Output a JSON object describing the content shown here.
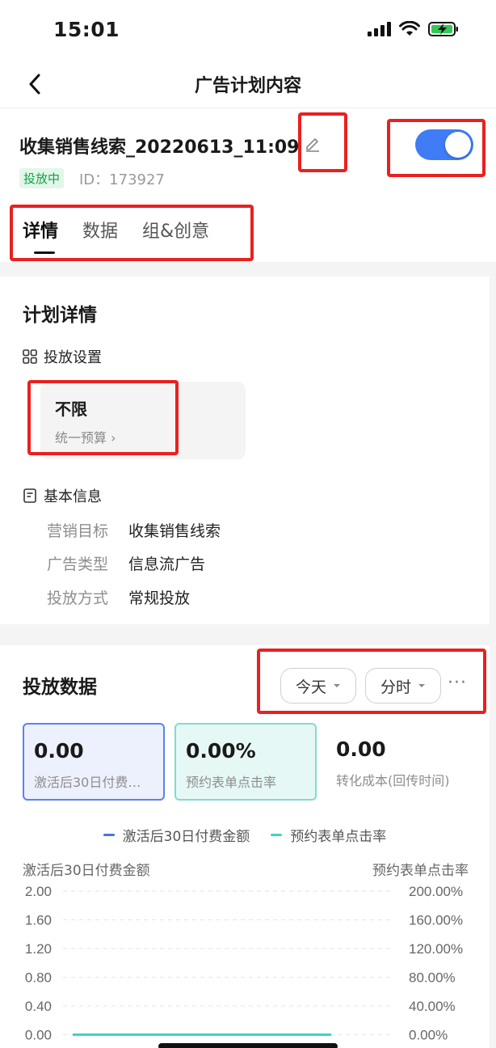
{
  "status_bar": {
    "time": "15:01"
  },
  "nav": {
    "title": "广告计划内容"
  },
  "plan": {
    "name": "收集销售线索_20220613_11:09",
    "status": "投放中",
    "id_label": "ID：",
    "id": "173927",
    "enabled": true
  },
  "tabs": [
    {
      "label": "详情",
      "active": true
    },
    {
      "label": "数据",
      "active": false
    },
    {
      "label": "组&创意",
      "active": false
    }
  ],
  "details": {
    "title": "计划详情",
    "delivery_settings": {
      "heading": "投放设置",
      "budget_value": "不限",
      "budget_link": "统一预算 ›"
    },
    "basic_info": {
      "heading": "基本信息",
      "rows": [
        {
          "label": "营销目标",
          "value": "收集销售线索"
        },
        {
          "label": "广告类型",
          "value": "信息流广告"
        },
        {
          "label": "投放方式",
          "value": "常规投放"
        }
      ]
    }
  },
  "delivery_data": {
    "title": "投放数据",
    "filters": [
      {
        "label": "今天"
      },
      {
        "label": "分时"
      }
    ],
    "more": "···",
    "metrics": [
      {
        "value": "0.00",
        "label": "激活后30日付费…",
        "style": "selected-blue"
      },
      {
        "value": "0.00%",
        "label": "预约表单点击率",
        "style": "selected-teal"
      },
      {
        "value": "0.00",
        "label": "转化成本(回传时间)",
        "style": "plain"
      }
    ]
  },
  "colors": {
    "accent_blue": "#3f7cf5",
    "series_blue": "#4a6fe8",
    "series_teal": "#3fd4c6",
    "status_green": "#14a046",
    "highlight_red": "#ea2020"
  },
  "chart_data": {
    "type": "line",
    "left_axis_label": "激活后30日付费金额",
    "right_axis_label": "预约表单点击率",
    "left_ticks": [
      "2.00",
      "1.60",
      "1.20",
      "0.80",
      "0.40",
      "0.00"
    ],
    "right_ticks": [
      "200.00%",
      "160.00%",
      "120.00%",
      "80.00%",
      "40.00%",
      "0.00%"
    ],
    "ylim_left": [
      0,
      2
    ],
    "ylim_right": [
      0,
      200
    ],
    "series": [
      {
        "name": "激活后30日付费金额",
        "color": "#4a6fe8",
        "values": [
          0,
          0,
          0,
          0,
          0,
          0
        ]
      },
      {
        "name": "预约表单点击率",
        "color": "#3fd4c6",
        "values": [
          0,
          0,
          0,
          0,
          0,
          0
        ]
      }
    ],
    "grid": true,
    "legend": "top-center"
  }
}
